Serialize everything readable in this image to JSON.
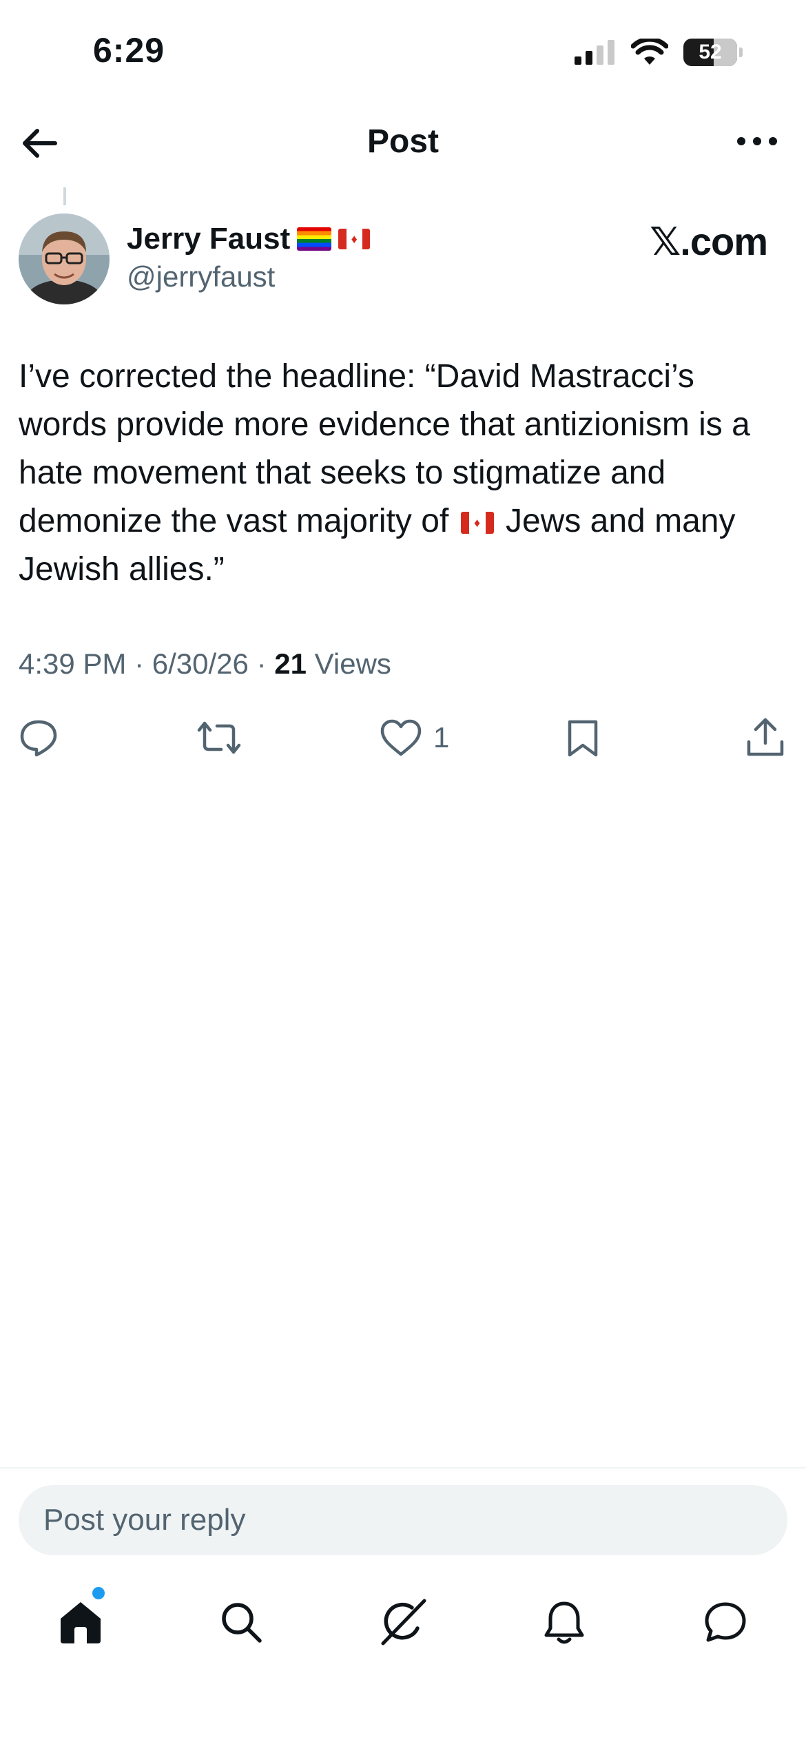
{
  "status_bar": {
    "time": "6:29",
    "battery_level": "52"
  },
  "nav": {
    "title": "Post"
  },
  "author": {
    "name": "Jerry Faust",
    "handle": "@jerryfaust",
    "badges": [
      "rainbow-flag",
      "canada-flag"
    ]
  },
  "source_logo": "𝕏.com",
  "post": {
    "text_before_flag": "I’ve corrected the headline:  “David Mastracci’s words provide more evidence that antizionism is a hate movement that seeks to stigmatize and demonize the vast majority of ",
    "inline_emoji": "canada-flag",
    "text_after_flag": " Jews and many Jewish allies.”"
  },
  "meta": {
    "time": "4:39 PM",
    "date": "6/30/26",
    "views_count": "21",
    "views_label": "Views",
    "separator": "·"
  },
  "actions": {
    "reply": {
      "icon": "reply-icon",
      "count": ""
    },
    "repost": {
      "icon": "repost-icon",
      "count": ""
    },
    "like": {
      "icon": "heart-icon",
      "count": "1"
    },
    "bookmark": {
      "icon": "bookmark-icon",
      "count": ""
    },
    "share": {
      "icon": "share-icon",
      "count": ""
    }
  },
  "reply_box": {
    "placeholder": "Post your reply"
  },
  "tabbar": {
    "items": [
      "home-icon",
      "search-icon",
      "grok-icon",
      "notifications-icon",
      "messages-icon"
    ],
    "accent": "#1d9bf0"
  }
}
